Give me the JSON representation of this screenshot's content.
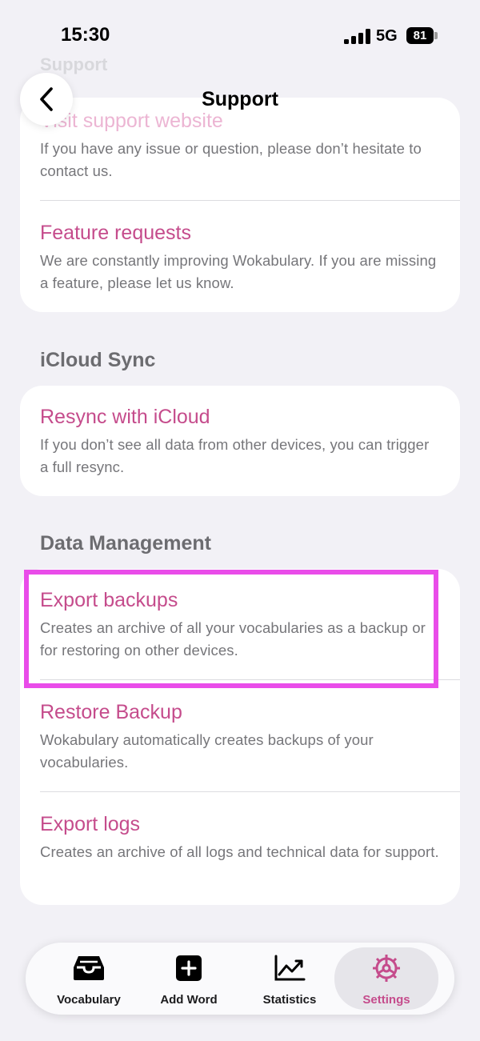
{
  "status": {
    "time": "15:30",
    "network": "5G",
    "battery": "81"
  },
  "nav": {
    "faded_section": "Support",
    "title": "Support"
  },
  "support": {
    "items": [
      {
        "title": "Visit support website",
        "desc": "If you have any issue or question, please don’t hesitate to contact us."
      },
      {
        "title": "Feature requests",
        "desc": "We are constantly improving Wokabulary. If you are missing a feature, please let us know."
      }
    ]
  },
  "icloud": {
    "header": "iCloud Sync",
    "items": [
      {
        "title": "Resync with iCloud",
        "desc": "If you don’t see all data from other devices, you can trigger a full resync."
      }
    ]
  },
  "data_management": {
    "header": "Data Management",
    "items": [
      {
        "title": "Export backups",
        "desc": "Creates an archive of all your vocabularies as a backup or for restoring on other devices."
      },
      {
        "title": "Restore Backup",
        "desc": "Wokabulary automatically creates backups of your vocabularies."
      },
      {
        "title": "Export logs",
        "desc": "Creates an archive of all logs and technical data for support."
      }
    ]
  },
  "tabs": [
    {
      "label": "Vocabulary",
      "icon": "tray-icon"
    },
    {
      "label": "Add Word",
      "icon": "plus-square-icon"
    },
    {
      "label": "Statistics",
      "icon": "chart-icon"
    },
    {
      "label": "Settings",
      "icon": "gear-icon"
    }
  ],
  "colors": {
    "accent": "#c54c8c",
    "highlight": "#e94ce9",
    "background": "#f2f1f6"
  }
}
